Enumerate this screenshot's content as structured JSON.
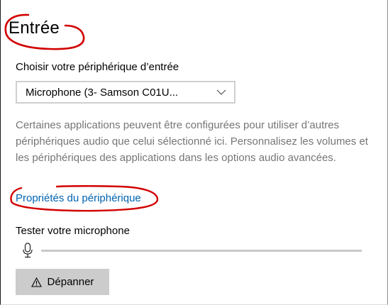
{
  "section": {
    "title": "Entrée"
  },
  "input_device": {
    "label": "Choisir votre périphérique d’entrée",
    "selected": "Microphone (3- Samson C01U...",
    "chevron_icon": "chevron-down-icon"
  },
  "description": "Certaines applications peuvent être configurées pour utiliser d’autres périphériques audio que celui sélectionné ici. Personnalisez les volumes et les périphériques des applications dans les options audio avancées.",
  "device_properties_link": "Propriétés du périphérique",
  "microphone_test": {
    "label": "Tester votre microphone",
    "level": 0,
    "icon": "microphone-icon"
  },
  "troubleshoot_button": {
    "label": "Dépanner",
    "icon": "warning-icon"
  },
  "colors": {
    "link": "#0063b1",
    "annotation": "#d20000",
    "secondary_text": "#767676",
    "button_bg": "#cccccc"
  }
}
